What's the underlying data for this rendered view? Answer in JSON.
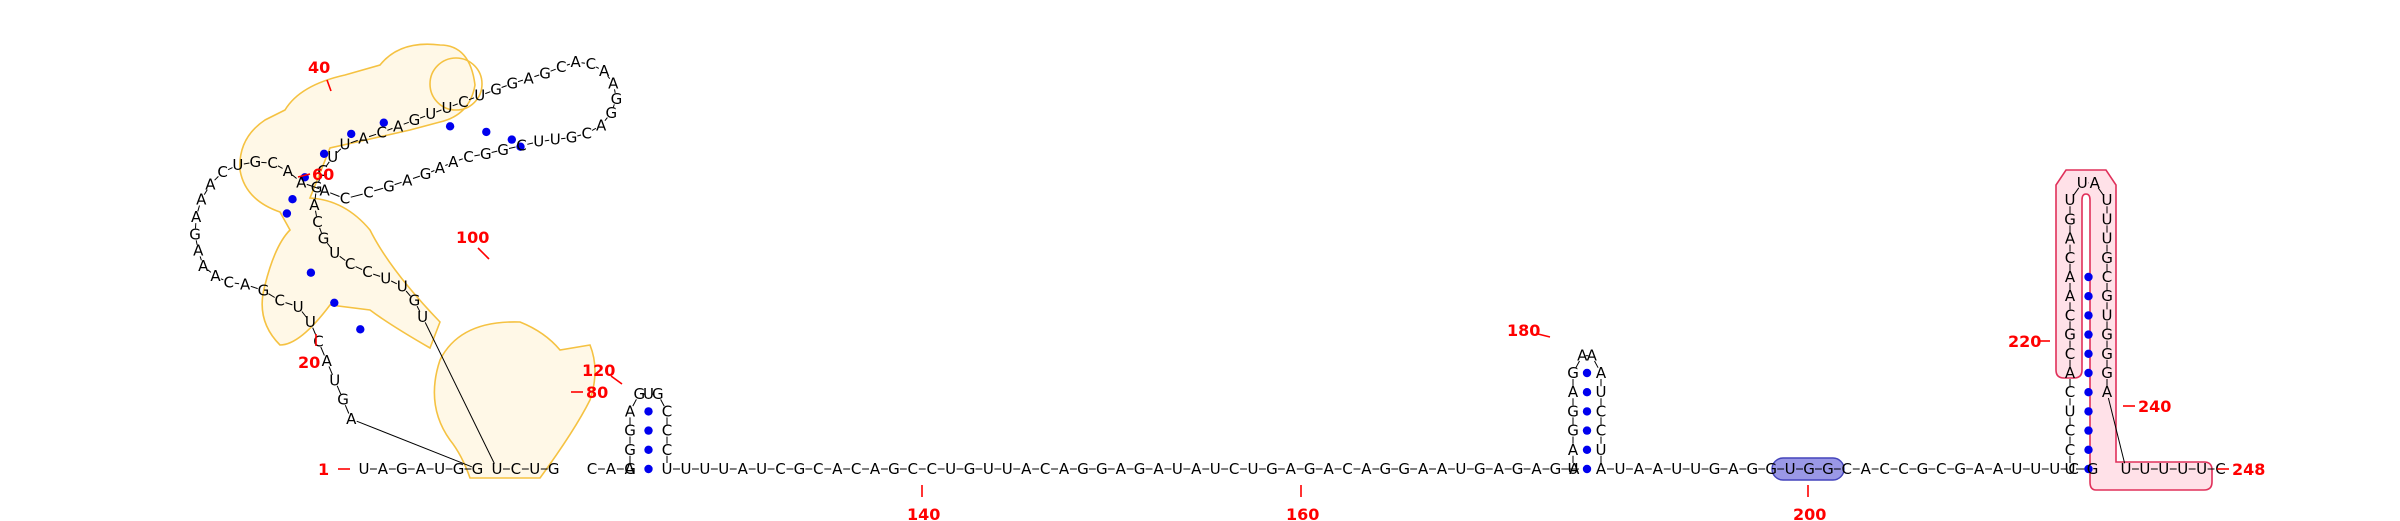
{
  "structure": {
    "sequence_length": 248,
    "trunk": {
      "seg1": "UAGAUGG",
      "seg2": "UCUG",
      "seg3": "CAA",
      "seg4": "UUUAUCGCACAGCCUGUUACAGGAGAUAUCUGAGACAGGAAUGAGAGA",
      "seg5": "UAAUUGAGGUGGCACCGCGAAUUUCG",
      "seg6": "UUUUUC"
    },
    "hairpin_180": {
      "left_up": "UAGGAG",
      "loop": "AA",
      "right_down": "AUCCUA"
    },
    "hairpin_240": {
      "left_up": "UCCUCACGCAACAGU",
      "loop": "UA",
      "right_down": "UUUGCGUGGGA"
    },
    "small_hairpin": {
      "left_up": "GGGA",
      "loop": "GUG",
      "right_down": "CCCU"
    },
    "multiloop_region": {
      "chain": "AGUACUUCGACAAAGAAACUGCAAACCGAGAACGGCUUGCAGGAACACGAGGUCUUGACAUUCGACGUCCUUGUU"
    }
  },
  "position_labels": {
    "n1": "1",
    "n20": "20",
    "n40": "40",
    "n60": "60",
    "n80": "80",
    "n100": "100",
    "n120": "120",
    "n140": "140",
    "n160": "160",
    "n180": "180",
    "n200": "200",
    "n220": "220",
    "n240": "240",
    "n248": "248"
  },
  "colors": {
    "label": "#ff0000",
    "pair_dot": "#0000ee",
    "highlight_yellow": "#f5c242",
    "highlight_red": "#e0305a",
    "highlight_blue": "#9a98e6"
  }
}
